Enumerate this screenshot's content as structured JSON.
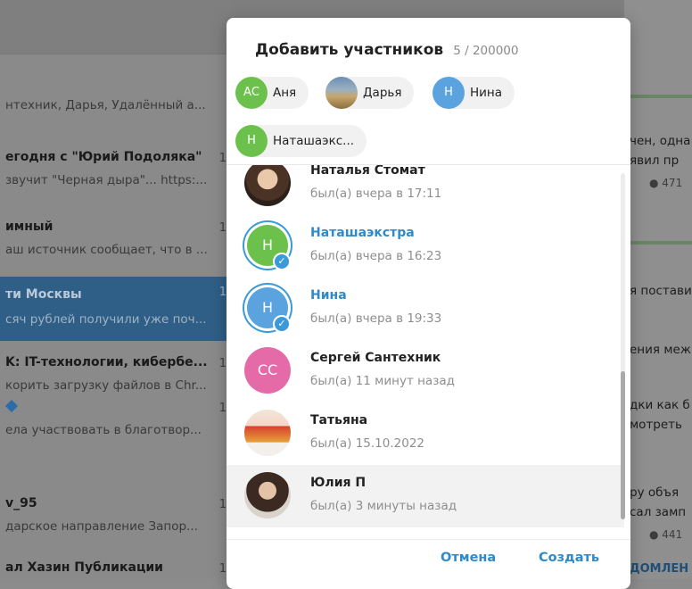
{
  "background": {
    "chats": [
      {
        "title": "",
        "preview": "нтехник, Дарья, Удалённый а...",
        "time": ""
      },
      {
        "title": "егодня с \"Юрий Подоляка\"",
        "preview": "звучит \"Черная дыра\"... https:...",
        "time": "1"
      },
      {
        "title": "имный",
        "preview": "аш источник сообщает, что в ...",
        "time": "1"
      },
      {
        "title": "ти Москвы",
        "preview": "сяч рублей получили уже поч...",
        "time": "1"
      },
      {
        "title": "K: IT-технологии, кибербе...",
        "preview": "корить загрузку файлов в Chr...",
        "time": "1"
      },
      {
        "title": "",
        "preview": "ела участвовать в благотвор...",
        "time": "1"
      },
      {
        "title": "v_95",
        "preview": "дарское направление Запор...",
        "time": "1"
      },
      {
        "title": "ал Хазин Публикации",
        "preview": "",
        "time": "1"
      }
    ],
    "right_texts": [
      "чен, одна",
      "явил пр",
      "я постави",
      "ения меж",
      "дки как б",
      "мотреть",
      "ру объя",
      "сал замп"
    ],
    "right_views": [
      "471",
      "441"
    ],
    "right_link": "ДОМЛЕН"
  },
  "dialog": {
    "title": "Добавить участников",
    "count": "5 / 200000",
    "chips": [
      {
        "initials": "АС",
        "name": "Аня",
        "color": "#6cc14c"
      },
      {
        "initials": "",
        "name": "Дарья",
        "color": "",
        "icon": "landscape-photo"
      },
      {
        "initials": "Н",
        "name": "Нина",
        "color": "#5ba3de"
      },
      {
        "initials": "Н",
        "name": "Наташаэкс...",
        "color": "#6cc14c"
      }
    ],
    "contacts": [
      {
        "name": "Наталья Стомат",
        "status": "был(а) вчера в 17:11",
        "initials": "",
        "color": "",
        "icon": "portrait-photo",
        "selected": false
      },
      {
        "name": "Наташаэкстра",
        "status": "был(а) вчера в 16:23",
        "initials": "Н",
        "color": "#6cc14c",
        "selected": true
      },
      {
        "name": "Нина",
        "status": "был(а) вчера в 19:33",
        "initials": "Н",
        "color": "#5ba3de",
        "selected": true
      },
      {
        "name": "Сергей Сантехник",
        "status": "был(а) 11 минут назад",
        "initials": "СС",
        "color": "#e56aa8",
        "selected": false
      },
      {
        "name": "Татьяна",
        "status": "был(а) 15.10.2022",
        "initials": "",
        "color": "",
        "icon": "poster-photo",
        "selected": false
      },
      {
        "name": "Юлия П",
        "status": "был(а) 3 минуты назад",
        "initials": "",
        "color": "",
        "icon": "portrait-photo",
        "selected": false
      }
    ],
    "cancel_label": "Отмена",
    "create_label": "Создать",
    "accent_color": "#2f8ac7"
  }
}
